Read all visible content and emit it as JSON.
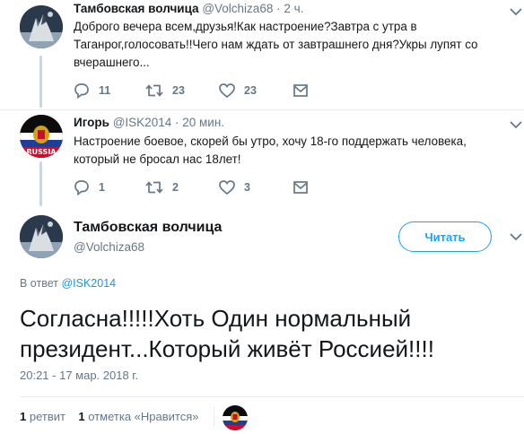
{
  "tweet1": {
    "name": "Тамбовская волчица",
    "handle": "@Volchiza68",
    "separator": "·",
    "time": "2 ч.",
    "text_line1": "Доброго вечера всем,друзья!Как настроение?Завтра с утра в",
    "text_line2": "Таганрог,голосовать!!Чего нам ждать от завтрашнего дня?Укры лупят со",
    "text_line3": "вчерашнего...",
    "replies": "11",
    "retweets": "23",
    "likes": "23"
  },
  "tweet2": {
    "name": "Игорь",
    "handle": "@ISK2014",
    "separator": "·",
    "time": "20 мин.",
    "text_line1": "Настроение боевое, скорей бы утро, хочу 18-го поддержать человека,",
    "text_line2": "который не бросал нас 18лет!",
    "replies": "1",
    "retweets": "2",
    "likes": "3"
  },
  "main_tweet": {
    "name": "Тамбовская волчица",
    "handle": "@Volchiza68",
    "follow_label": "Читать",
    "replying_prefix": "В ответ",
    "replying_to": "@ISK2014",
    "text_line1": "Согласна!!!!!Хоть Один нормальный",
    "text_line2": "президент...Который живёт Россией!!!!",
    "timestamp": "20:21 - 17 мар. 2018 г.",
    "retweet_count": "1",
    "retweet_label": "ретвит",
    "like_count": "1",
    "like_label": "отметка «Нравится»"
  },
  "icons": {
    "reply": "reply-icon",
    "retweet": "retweet-icon",
    "like": "heart-icon",
    "dm": "envelope-icon",
    "menu": "chevron-down-icon"
  },
  "colors": {
    "link": "#1b95e0",
    "accent": "#1da1f2",
    "muted": "#657786",
    "text": "#14171a"
  }
}
